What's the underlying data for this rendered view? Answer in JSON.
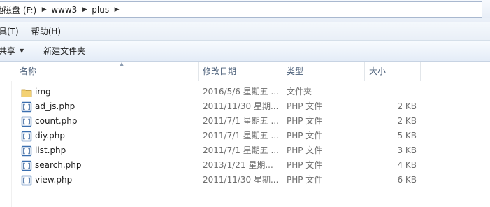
{
  "address": {
    "crumbs": [
      {
        "label": "地磁盘 (F:)"
      },
      {
        "label": "www3"
      },
      {
        "label": "plus"
      }
    ]
  },
  "menu": {
    "items": [
      "具(T)",
      "帮助(H)"
    ]
  },
  "toolbar": {
    "share_label": "共享",
    "new_folder_label": "新建文件夹"
  },
  "columns": {
    "name": "名称",
    "date": "修改日期",
    "type": "类型",
    "size": "大小"
  },
  "files": [
    {
      "name": "img",
      "date": "2016/5/6 星期五 ...",
      "type": "文件夹",
      "size": "",
      "icon": "folder-icon"
    },
    {
      "name": "ad_js.php",
      "date": "2011/11/30 星期...",
      "type": "PHP 文件",
      "size": "2 KB",
      "icon": "php-file-icon"
    },
    {
      "name": "count.php",
      "date": "2011/7/1 星期五 ...",
      "type": "PHP 文件",
      "size": "2 KB",
      "icon": "php-file-icon"
    },
    {
      "name": "diy.php",
      "date": "2011/7/1 星期五 ...",
      "type": "PHP 文件",
      "size": "5 KB",
      "icon": "php-file-icon"
    },
    {
      "name": "list.php",
      "date": "2011/7/1 星期五 ...",
      "type": "PHP 文件",
      "size": "3 KB",
      "icon": "php-file-icon"
    },
    {
      "name": "search.php",
      "date": "2013/1/21 星期...",
      "type": "PHP 文件",
      "size": "4 KB",
      "icon": "php-file-icon"
    },
    {
      "name": "view.php",
      "date": "2011/11/30 星期...",
      "type": "PHP 文件",
      "size": "6 KB",
      "icon": "php-file-icon"
    }
  ],
  "colors": {
    "header_text": "#4c607a",
    "meta_text": "#6d6d6d",
    "folder": "#e8c25a",
    "php_icon": "#3a6fb0"
  }
}
